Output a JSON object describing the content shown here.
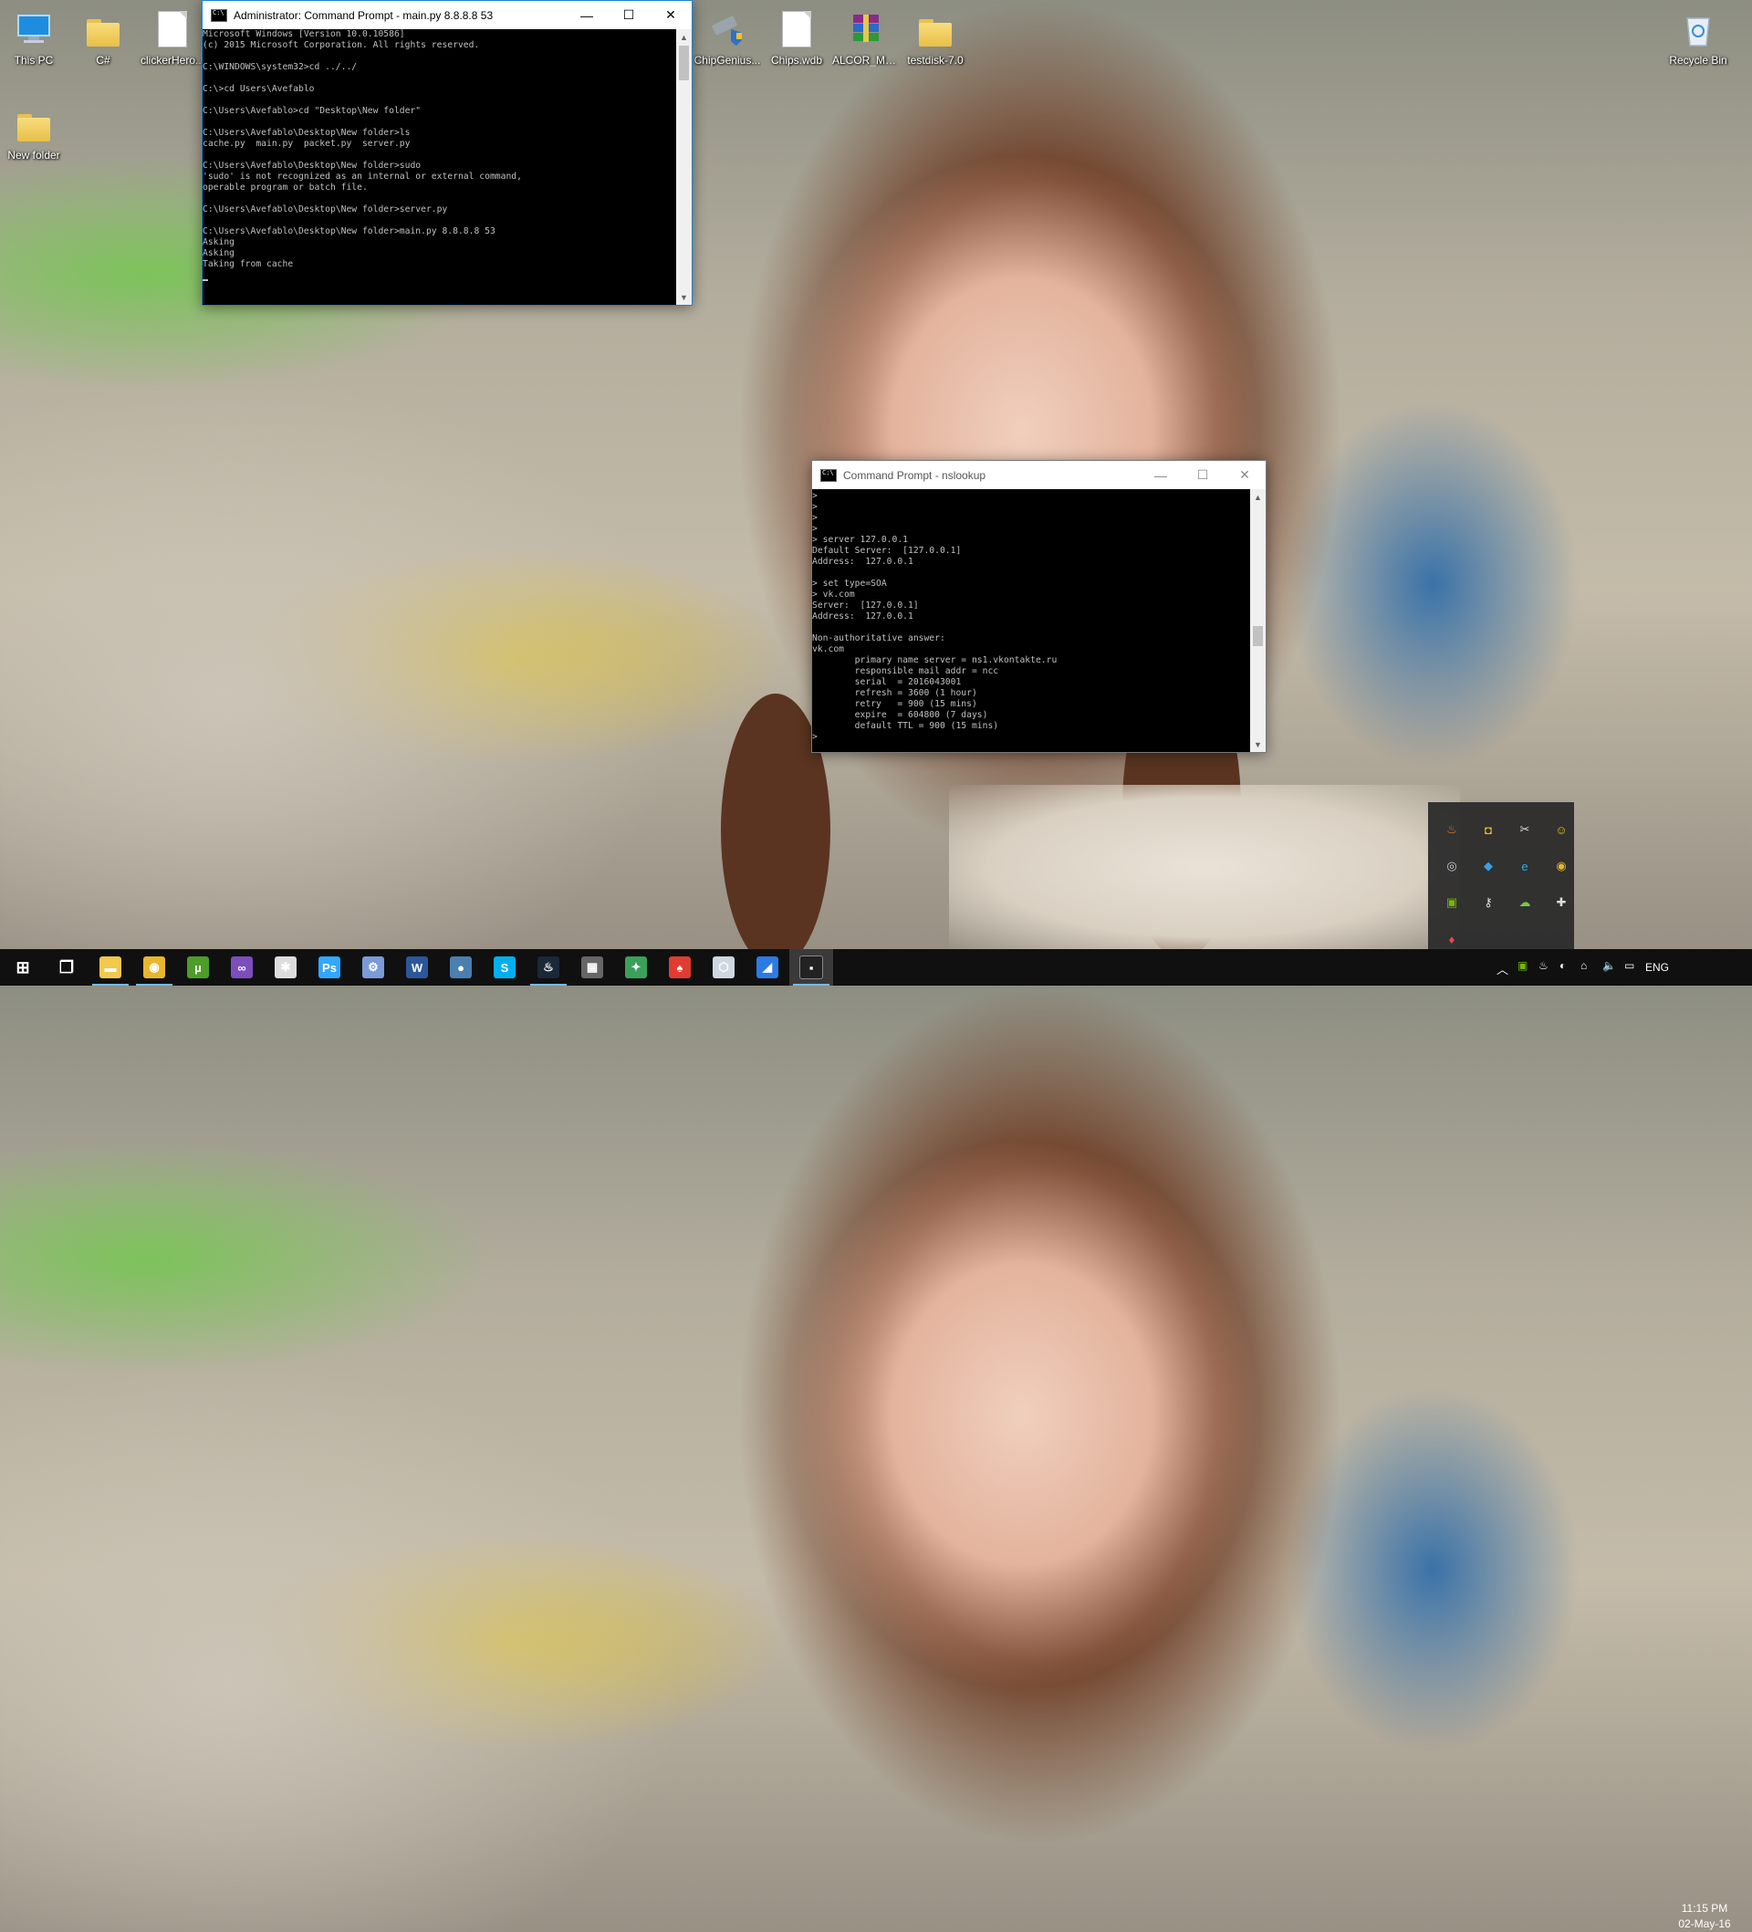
{
  "desktop": {
    "icons_left": [
      {
        "label": "This PC",
        "icon": "computer-icon"
      },
      {
        "label": "C#",
        "icon": "folder-icon"
      },
      {
        "label": "clickerHero...",
        "icon": "document-icon"
      },
      {
        "label": "New folder",
        "icon": "folder-icon"
      }
    ],
    "icons_right": [
      {
        "label": "ChipGenius...",
        "icon": "usb-shield-icon"
      },
      {
        "label": "Chips.wdb",
        "icon": "document-icon"
      },
      {
        "label": "ALCOR_MP...",
        "icon": "winrar-archive-icon"
      },
      {
        "label": "testdisk-7.0",
        "icon": "folder-icon"
      },
      {
        "label": "Recycle Bin",
        "icon": "recycle-bin-icon"
      }
    ]
  },
  "window_admin": {
    "title": "Administrator: Command Prompt - main.py  8.8.8.8 53",
    "lines": [
      "Microsoft Windows [Version 10.0.10586]",
      "(c) 2015 Microsoft Corporation. All rights reserved.",
      "",
      "C:\\WINDOWS\\system32>cd ../../",
      "",
      "C:\\>cd Users\\Avefablo",
      "",
      "C:\\Users\\Avefablo>cd \"Desktop\\New folder\"",
      "",
      "C:\\Users\\Avefablo\\Desktop\\New folder>ls",
      "cache.py  main.py  packet.py  server.py",
      "",
      "C:\\Users\\Avefablo\\Desktop\\New folder>sudo",
      "'sudo' is not recognized as an internal or external command,",
      "operable program or batch file.",
      "",
      "C:\\Users\\Avefablo\\Desktop\\New folder>server.py",
      "",
      "C:\\Users\\Avefablo\\Desktop\\New folder>main.py 8.8.8.8 53",
      "Asking",
      "Asking",
      "Taking from cache"
    ]
  },
  "window_nslookup": {
    "title": "Command Prompt - nslookup",
    "lines": [
      ">",
      ">",
      ">",
      ">",
      "> server 127.0.0.1",
      "Default Server:  [127.0.0.1]",
      "Address:  127.0.0.1",
      "",
      "> set type=SOA",
      "> vk.com",
      "Server:  [127.0.0.1]",
      "Address:  127.0.0.1",
      "",
      "Non-authoritative answer:",
      "vk.com",
      "        primary name server = ns1.vkontakte.ru",
      "        responsible mail addr = ncc",
      "        serial  = 2016043001",
      "        refresh = 3600 (1 hour)",
      "        retry   = 900 (15 mins)",
      "        expire  = 604800 (7 days)",
      "        default TTL = 900 (15 mins)",
      ">"
    ]
  },
  "window_buttons": {
    "minimize": "—",
    "maximize": "☐",
    "close": "✕"
  },
  "tray_flyout": [
    {
      "icon": "java-update-icon",
      "glyph": "♨",
      "color": "#f07f1a"
    },
    {
      "icon": "lock-app-icon",
      "glyph": "◘",
      "color": "#f0c030"
    },
    {
      "icon": "snipping-tool-icon",
      "glyph": "✂",
      "color": "#dddddd"
    },
    {
      "icon": "emoji-app-icon",
      "glyph": "☺",
      "color": "#f5c518"
    },
    {
      "icon": "search-app-icon",
      "glyph": "◎",
      "color": "#cccccc"
    },
    {
      "icon": "network-monitor-icon",
      "glyph": "◆",
      "color": "#3aa0e0"
    },
    {
      "icon": "e-app-icon",
      "glyph": "e",
      "color": "#2ab0e8"
    },
    {
      "icon": "chrome-icon",
      "glyph": "◉",
      "color": "#e9b72c"
    },
    {
      "icon": "nvidia-icon",
      "glyph": "▣",
      "color": "#76b900"
    },
    {
      "icon": "usb-tool-icon",
      "glyph": "⚷",
      "color": "#dddddd"
    },
    {
      "icon": "cloud-sync-icon",
      "glyph": "☁",
      "color": "#7ac943"
    },
    {
      "icon": "gamepad-icon",
      "glyph": "✚",
      "color": "#dddddd"
    },
    {
      "icon": "hardware-tool-icon",
      "glyph": "♦",
      "color": "#e84b4b"
    }
  ],
  "taskbar": {
    "apps": [
      {
        "name": "start-button",
        "glyph": "⊞"
      },
      {
        "name": "task-view-icon",
        "glyph": "❐"
      },
      {
        "name": "file-explorer-icon",
        "glyph": "▬"
      },
      {
        "name": "chrome-icon",
        "glyph": "◉"
      },
      {
        "name": "utorrent-icon",
        "glyph": "µ"
      },
      {
        "name": "visual-studio-icon",
        "glyph": "∞"
      },
      {
        "name": "app-icon-spider",
        "glyph": "✱"
      },
      {
        "name": "photoshop-icon",
        "glyph": "Ps"
      },
      {
        "name": "network-tool-icon",
        "glyph": "⚙"
      },
      {
        "name": "word-icon",
        "glyph": "W"
      },
      {
        "name": "app-icon-circle",
        "glyph": "●"
      },
      {
        "name": "skype-icon",
        "glyph": "S"
      },
      {
        "name": "steam-icon",
        "glyph": "♨"
      },
      {
        "name": "media-app-icon",
        "glyph": "▦"
      },
      {
        "name": "gamepad-app-icon",
        "glyph": "✦"
      },
      {
        "name": "red-app-icon",
        "glyph": "♠"
      },
      {
        "name": "cube-app-icon",
        "glyph": "⬡"
      },
      {
        "name": "blue-app-icon",
        "glyph": "◢"
      },
      {
        "name": "command-prompt-icon",
        "glyph": "▪"
      }
    ],
    "language": "ENG",
    "time": "11:15 PM",
    "date": "02-May-16"
  }
}
